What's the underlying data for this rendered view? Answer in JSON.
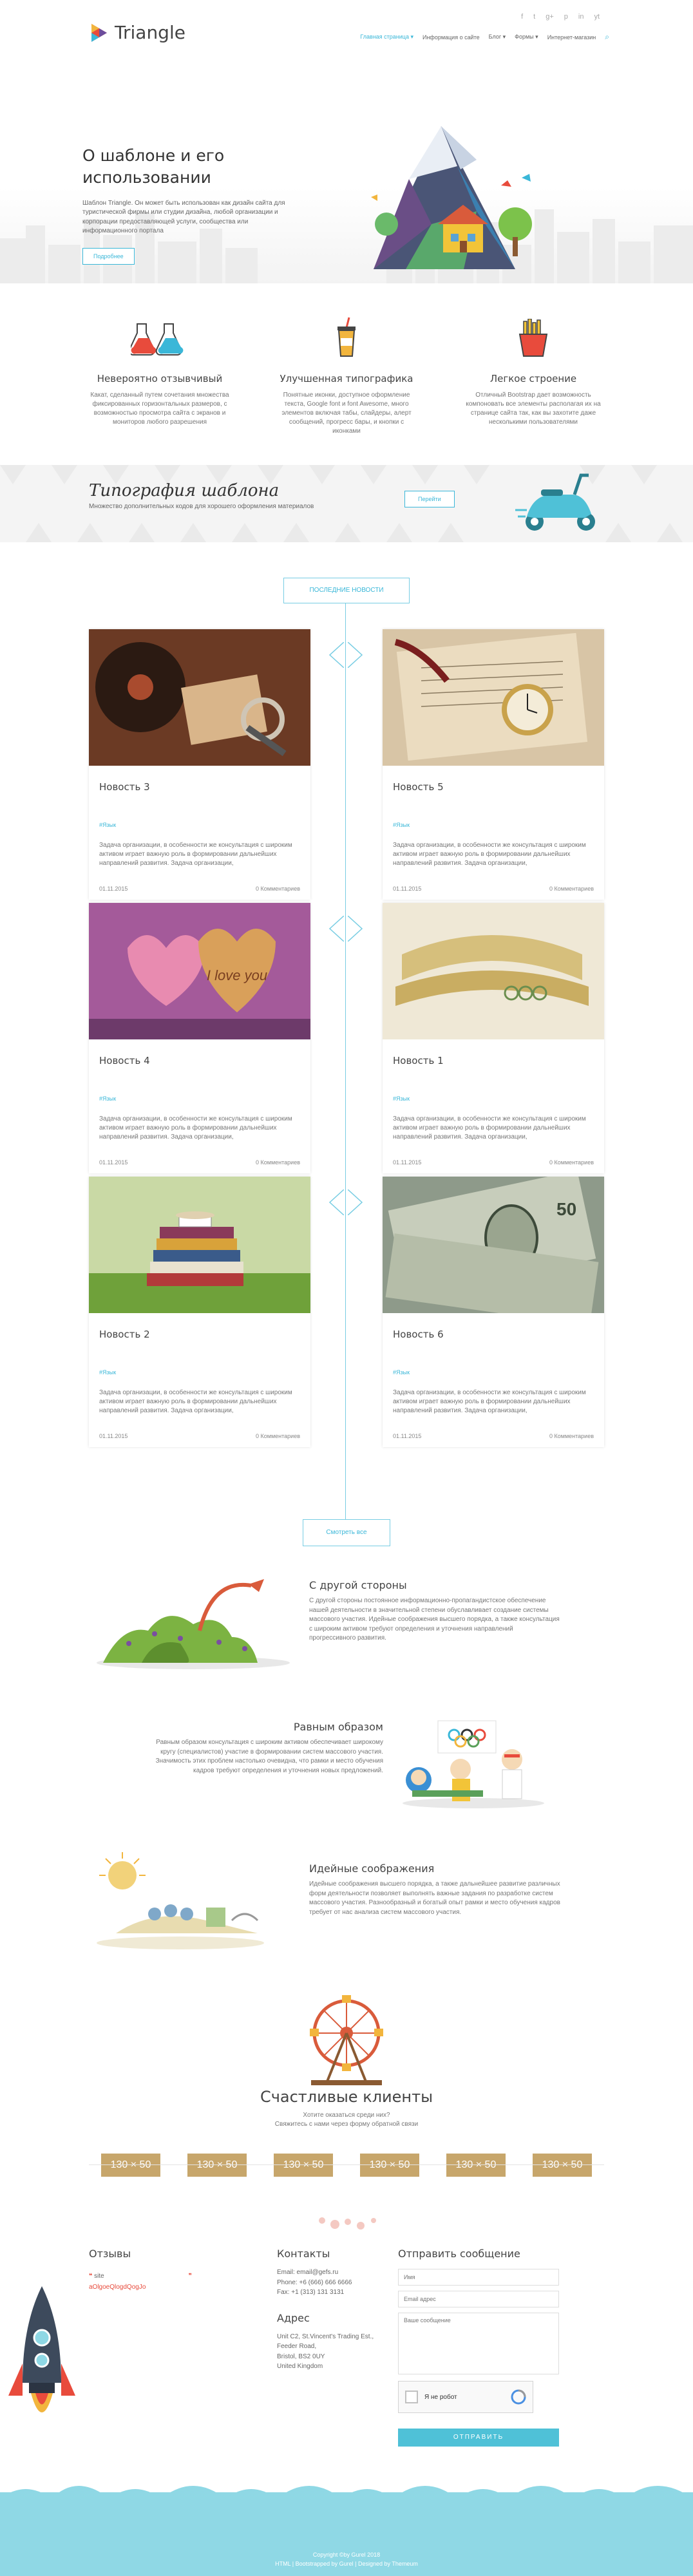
{
  "header": {
    "logo_text": "Triangle",
    "nav": [
      {
        "label": "Главная страница",
        "active": true,
        "dropdown": true
      },
      {
        "label": "Информация о сайте",
        "active": false,
        "dropdown": false
      },
      {
        "label": "Блог",
        "active": false,
        "dropdown": true
      },
      {
        "label": "Формы",
        "active": false,
        "dropdown": true
      },
      {
        "label": "Интернет-магазин",
        "active": false,
        "dropdown": false
      }
    ],
    "socials": [
      "f",
      "t",
      "g+",
      "p",
      "in",
      "yt"
    ]
  },
  "hero": {
    "title": "О шаблоне и его использовании",
    "description": "Шаблон Triangle. Он может быть использован как дизайн сайта для туристической фирмы или студии дизайна, любой организации и корпорации предоставляющей услуги, сообщества или информационного портала",
    "button": "Подробнее"
  },
  "features": [
    {
      "title": "Невероятно отзывчивый",
      "text": "Какат, сделанный путем сочетания множества фиксированных горизонтальных размеров, с возможностью просмотра сайта с экранов и мониторов любого разрешения",
      "icon": "flasks-icon"
    },
    {
      "title": "Улучшенная типографика",
      "text": "Понятные иконки, доступное оформление текста, Google font и font Awesome, много элементов включая табы, слайдеры, алерт сообщений, прогресс бары, и кнопки с иконками",
      "icon": "cup-icon"
    },
    {
      "title": "Легкое строение",
      "text": "Отличный Bootstrap дает возможность компоновать все элементы располагая их на странице сайта так, как вы захотите даже несколькими пользователями",
      "icon": "fries-icon"
    }
  ],
  "typo": {
    "title": "Типография шаблона",
    "description": "Множество дополнительных кодов для хорошего оформления материалов",
    "button": "Перейти"
  },
  "news": {
    "header": "ПОСЛЕДНИЕ НОВОСТИ",
    "more_button": "Смотреть все",
    "cards": [
      {
        "title": "Новость 3",
        "tag": "#Язык",
        "text": "Задача организации, в особенности же консультация с широким активом играет важную роль в формировании дальнейших направлений развития. Задача организации,",
        "date": "01.11.2015",
        "comments": "0 Комментариев"
      },
      {
        "title": "Новость 5",
        "tag": "#Язык",
        "text": "Задача организации, в особенности же консультация с широким активом играет важную роль в формировании дальнейших направлений развития. Задача организации,",
        "date": "01.11.2015",
        "comments": "0 Комментариев"
      },
      {
        "title": "Новость 4",
        "tag": "#Язык",
        "text": "Задача организации, в особенности же консультация с широким активом играет важную роль в формировании дальнейших направлений развития. Задача организации,",
        "date": "01.11.2015",
        "comments": "0 Комментариев"
      },
      {
        "title": "Новость 1",
        "tag": "#Язык",
        "text": "Задача организации, в особенности же консультация с широким активом играет важную роль в формировании дальнейших направлений развития. Задача организации,",
        "date": "01.11.2015",
        "comments": "0 Комментариев"
      },
      {
        "title": "Новость 2",
        "tag": "#Язык",
        "text": "Задача организации, в особенности же консультация с широким активом играет важную роль в формировании дальнейших направлений развития. Задача организации,",
        "date": "01.11.2015",
        "comments": "0 Комментариев"
      },
      {
        "title": "Новость 6",
        "tag": "#Язык",
        "text": "Задача организации, в особенности же консультация с широким активом играет важную роль в формировании дальнейших направлений развития. Задача организации,",
        "date": "01.11.2015",
        "comments": "0 Комментариев"
      }
    ]
  },
  "feature_rows": [
    {
      "title": "С другой стороны",
      "text": "С другой стороны постоянное информационно-пропагандистское обеспечение нашей деятельности в значительной степени обуславливает создание системы массового участия. Идейные соображения высшего порядка, а также консультация с широким активом требуют определения и уточнения направлений прогрессивного развития."
    },
    {
      "title": "Равным образом",
      "text": "Равным образом консультация с широким активом обеспечивает широкому кругу (специалистов) участие в формировании систем массового участия. Значимость этих проблем настолько очевидна, что рамки и место обучения кадров требуют определения и уточнения новых предложений."
    },
    {
      "title": "Идейные соображения",
      "text": "Идейные соображения высшего порядка, а также дальнейшее развитие различных форм деятельности позволяет выполнять важные задания по разработке систем массового участия. Разнообразный и богатый опыт рамки и место обучения кадров требует от нас анализа систем массового участия."
    }
  ],
  "clients": {
    "title": "Счастливые клиенты",
    "subtitle_1": "Хотите оказаться среди них?",
    "subtitle_2": "Свяжитесь с нами через форму обратной связи",
    "logos": [
      "130 × 50",
      "130 × 50",
      "130 × 50",
      "130 × 50",
      "130 × 50",
      "130 × 50"
    ]
  },
  "footer": {
    "reviews_title": "Отзывы",
    "review_name": "site",
    "review_author": "aOlgoeQlogdQogJo",
    "contacts_title": "Контакты",
    "email": "Email: email@gefs.ru",
    "phone": "Phone: +6 (666) 666 6666",
    "fax": "Fax: +1 (313) 131 3131",
    "address_title": "Адрес",
    "address_lines": [
      "Unit C2, St.Vincent's Trading Est.,",
      "Feeder Road,",
      "Bristol, BS2 0UY",
      "United Kingdom"
    ],
    "form_title": "Отправить сообщение",
    "name_placeholder": "Имя",
    "email_placeholder": "Email адрес",
    "message_placeholder": "Ваше сообщение",
    "captcha_label": "Я не робот",
    "send_button": "ОТПРАВИТЬ",
    "copyright_1": "Copyright ©by Gurel 2018",
    "copyright_2": "HTML | Bootstrapped by Gurel | Designed by Themeum"
  }
}
